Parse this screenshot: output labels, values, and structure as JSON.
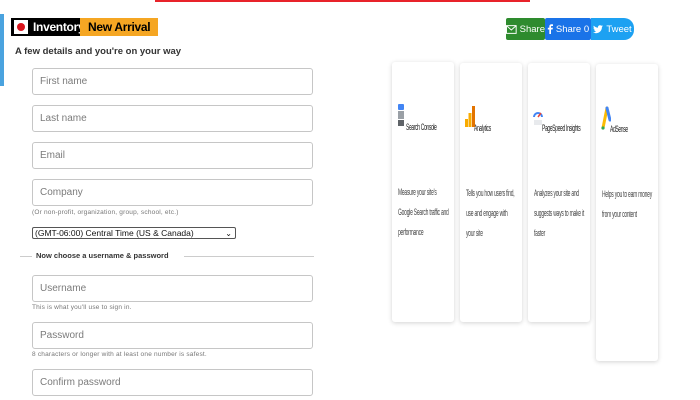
{
  "header": {
    "inventory_label": "Inventory",
    "new_arrival_label": "New Arrival"
  },
  "form": {
    "title": "A few details and you're on your way",
    "first_name_placeholder": "First name",
    "last_name_placeholder": "Last name",
    "email_placeholder": "Email",
    "company_placeholder": "Company",
    "company_hint": "(Or non-profit, organization, group, school, etc.)",
    "timezone_value": "(GMT-06:00) Central Time (US & Canada)",
    "section_label": "Now choose a username & password",
    "username_placeholder": "Username",
    "username_hint": "This is what you'll use to sign in.",
    "password_placeholder": "Password",
    "password_hint": "8 characters or longer with at least one number is safest.",
    "confirm_password_placeholder": "Confirm password"
  },
  "share": {
    "email_label": "Share",
    "facebook_label": "Share 0",
    "twitter_label": "Tweet"
  },
  "cards": [
    {
      "title": "Search Console",
      "desc": "Measure your site's Google Search traffic and performance"
    },
    {
      "title": "Analytics",
      "desc": "Tells you how users find, use and engage with your site"
    },
    {
      "title": "PageSpeed Insights",
      "desc": "Analyzes your site and suggests ways to make it faster"
    },
    {
      "title": "AdSense",
      "desc": "Helps you to earn money from your content"
    }
  ],
  "colors": {
    "accent_blue": "#4aa3df",
    "new_arrival_orange": "#f5a623",
    "email_green": "#2e8b2e",
    "facebook_blue": "#1a73e8",
    "twitter_blue": "#1da1f2"
  }
}
